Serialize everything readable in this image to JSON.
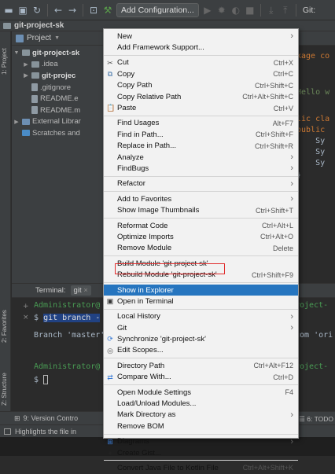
{
  "toolbar": {
    "add_configuration": "Add Configuration...",
    "git_label": "Git:"
  },
  "breadcrumb": {
    "project": "git-project-sk"
  },
  "left_stripe": {
    "project_tab": "1: Project",
    "favorites_tab": "2: Favorites",
    "structure_tab": "Z: Structure"
  },
  "project_panel": {
    "header": "Project",
    "tree": [
      {
        "label": "git-project-sk",
        "bold": true,
        "indent": 0,
        "arrow": "▼",
        "icon": "folder"
      },
      {
        "label": ".idea",
        "bold": false,
        "indent": 1,
        "arrow": "▶",
        "icon": "folder"
      },
      {
        "label": "git-projec",
        "bold": true,
        "indent": 1,
        "arrow": "▶",
        "icon": "folder"
      },
      {
        "label": ".gitignore",
        "bold": false,
        "indent": 1,
        "arrow": "",
        "icon": "file"
      },
      {
        "label": "README.e",
        "bold": false,
        "indent": 1,
        "arrow": "",
        "icon": "file"
      },
      {
        "label": "README.m",
        "bold": false,
        "indent": 1,
        "arrow": "",
        "icon": "file"
      },
      {
        "label": "External Librar",
        "bold": false,
        "indent": 0,
        "arrow": "▶",
        "icon": "lib"
      },
      {
        "label": "Scratches and",
        "bold": false,
        "indent": 0,
        "arrow": "",
        "icon": "scratch"
      }
    ]
  },
  "editor": {
    "lines": [
      {
        "text": "kage co",
        "cls": "kw"
      },
      {
        "text": "Hello w",
        "cls": "str"
      },
      {
        "text": "lic cla",
        "cls": "kw"
      },
      {
        "text": "public",
        "cls": "kw"
      },
      {
        "text": "    Sy",
        "cls": "plain"
      },
      {
        "text": "    Sy",
        "cls": "plain"
      },
      {
        "text": "    Sy",
        "cls": "plain"
      },
      {
        "text": "}",
        "cls": "plain"
      }
    ]
  },
  "terminal": {
    "tab_label": "Terminal:",
    "session": "git",
    "line1": "Administrator@",
    "line1_right": "roject-",
    "cmd_prompt": "$",
    "cmd": "git branch -",
    "branch_line": "Branch 'master'",
    "branch_right": "com 'ori",
    "line4": "Administrator@",
    "line4_right": "roject-",
    "prompt2": "$"
  },
  "bottom_bar": {
    "version_control": "9: Version Contro",
    "todo": "6: TODO"
  },
  "status_bar": {
    "text": "Highlights the file in"
  },
  "context_menu": {
    "items": [
      {
        "label": "New",
        "shortcut": "",
        "submenu": true,
        "icon": ""
      },
      {
        "label": "Add Framework Support...",
        "shortcut": "",
        "submenu": false,
        "icon": ""
      },
      {
        "sep": true
      },
      {
        "label": "Cut",
        "shortcut": "Ctrl+X",
        "submenu": false,
        "icon": "cut-icon"
      },
      {
        "label": "Copy",
        "shortcut": "Ctrl+C",
        "submenu": false,
        "icon": "copy-icon"
      },
      {
        "label": "Copy Path",
        "shortcut": "Ctrl+Shift+C",
        "submenu": false,
        "icon": ""
      },
      {
        "label": "Copy Relative Path",
        "shortcut": "Ctrl+Alt+Shift+C",
        "submenu": false,
        "icon": ""
      },
      {
        "label": "Paste",
        "shortcut": "Ctrl+V",
        "submenu": false,
        "icon": "paste-icon"
      },
      {
        "sep": true
      },
      {
        "label": "Find Usages",
        "shortcut": "Alt+F7",
        "submenu": false,
        "icon": ""
      },
      {
        "label": "Find in Path...",
        "shortcut": "Ctrl+Shift+F",
        "submenu": false,
        "icon": ""
      },
      {
        "label": "Replace in Path...",
        "shortcut": "Ctrl+Shift+R",
        "submenu": false,
        "icon": ""
      },
      {
        "label": "Analyze",
        "shortcut": "",
        "submenu": true,
        "icon": ""
      },
      {
        "label": "FindBugs",
        "shortcut": "",
        "submenu": true,
        "icon": ""
      },
      {
        "sep": true
      },
      {
        "label": "Refactor",
        "shortcut": "",
        "submenu": true,
        "icon": ""
      },
      {
        "sep": true
      },
      {
        "label": "Add to Favorites",
        "shortcut": "",
        "submenu": true,
        "icon": ""
      },
      {
        "label": "Show Image Thumbnails",
        "shortcut": "Ctrl+Shift+T",
        "submenu": false,
        "icon": ""
      },
      {
        "sep": true
      },
      {
        "label": "Reformat Code",
        "shortcut": "Ctrl+Alt+L",
        "submenu": false,
        "icon": ""
      },
      {
        "label": "Optimize Imports",
        "shortcut": "Ctrl+Alt+O",
        "submenu": false,
        "icon": ""
      },
      {
        "label": "Remove Module",
        "shortcut": "Delete",
        "submenu": false,
        "icon": ""
      },
      {
        "sep": true
      },
      {
        "label": "Build Module 'git-project-sk'",
        "shortcut": "",
        "submenu": false,
        "icon": ""
      },
      {
        "label": "Rebuild Module 'git-project-sk'",
        "shortcut": "Ctrl+Shift+F9",
        "submenu": false,
        "icon": ""
      },
      {
        "sep": true
      },
      {
        "label": "Show in Explorer",
        "shortcut": "",
        "submenu": false,
        "icon": "",
        "highlight": true
      },
      {
        "label": "Open in Terminal",
        "shortcut": "",
        "submenu": false,
        "icon": "terminal-icon"
      },
      {
        "sep": true
      },
      {
        "label": "Local History",
        "shortcut": "",
        "submenu": true,
        "icon": ""
      },
      {
        "label": "Git",
        "shortcut": "",
        "submenu": true,
        "icon": ""
      },
      {
        "label": "Synchronize 'git-project-sk'",
        "shortcut": "",
        "submenu": false,
        "icon": "sync-icon"
      },
      {
        "label": "Edit Scopes...",
        "shortcut": "",
        "submenu": false,
        "icon": "scope-icon"
      },
      {
        "sep": true
      },
      {
        "label": "Directory Path",
        "shortcut": "Ctrl+Alt+F12",
        "submenu": false,
        "icon": ""
      },
      {
        "label": "Compare With...",
        "shortcut": "Ctrl+D",
        "submenu": false,
        "icon": "compare-icon"
      },
      {
        "sep": true
      },
      {
        "label": "Open Module Settings",
        "shortcut": "F4",
        "submenu": false,
        "icon": ""
      },
      {
        "label": "Load/Unload Modules...",
        "shortcut": "",
        "submenu": false,
        "icon": ""
      },
      {
        "label": "Mark Directory as",
        "shortcut": "",
        "submenu": true,
        "icon": ""
      },
      {
        "label": "Remove BOM",
        "shortcut": "",
        "submenu": false,
        "icon": ""
      },
      {
        "sep": true
      },
      {
        "label": "Diagrams",
        "shortcut": "",
        "submenu": true,
        "icon": "diagram-icon"
      },
      {
        "label": "Create Gist...",
        "shortcut": "",
        "submenu": false,
        "icon": "github-icon"
      },
      {
        "sep": true
      },
      {
        "label": "Convert Java File to Kotlin File",
        "shortcut": "Ctrl+Alt+Shift+K",
        "submenu": false,
        "icon": ""
      }
    ]
  },
  "colors": {
    "highlight": "#2675bf",
    "outline": "#e02b2b",
    "menu_bg": "#f2f2f2",
    "ide_bg": "#2b2b2b"
  }
}
